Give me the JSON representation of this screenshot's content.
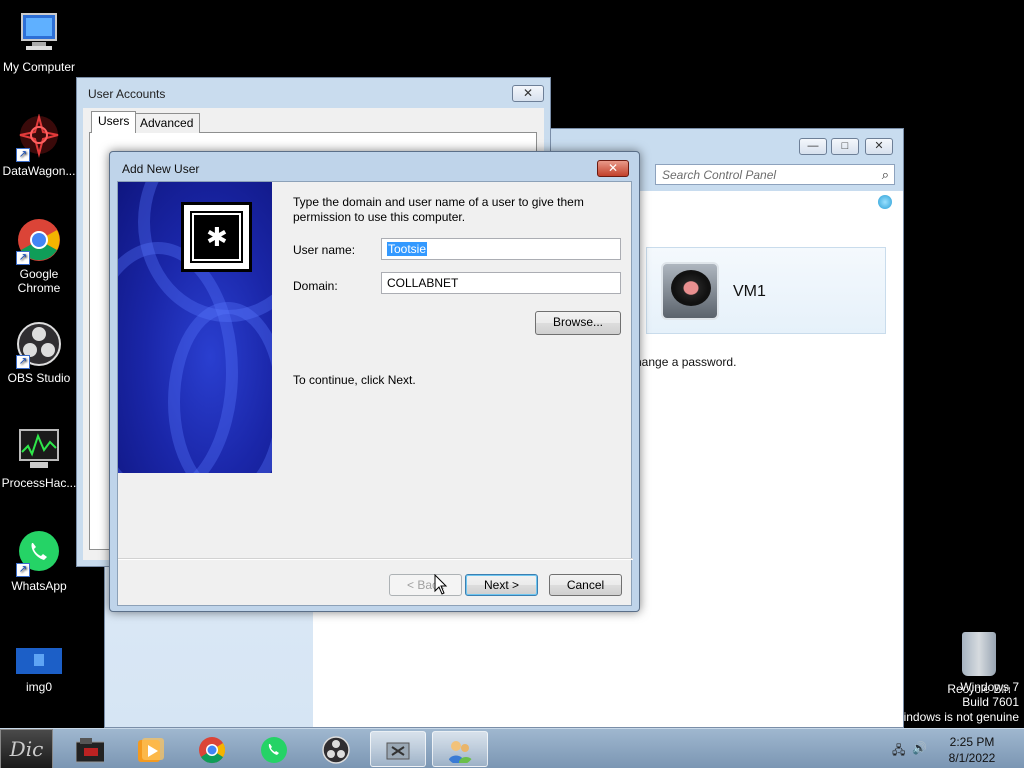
{
  "desktop": {
    "icons": [
      {
        "label": "My Computer"
      },
      {
        "label": "DataWagon..."
      },
      {
        "label": "Google Chrome"
      },
      {
        "label": "OBS Studio"
      },
      {
        "label": "ProcessHac..."
      },
      {
        "label": "WhatsApp"
      },
      {
        "label": "img0"
      }
    ],
    "recycle_bin": {
      "label": "Recycle Bin"
    },
    "watermark": {
      "line1": "Windows 7",
      "line2": "Build 7601",
      "line3": "indows is not genuine"
    }
  },
  "control_panel": {
    "search_placeholder": "Search Control Panel",
    "user_card_name": "VM1",
    "change_password_text": "hange a password."
  },
  "user_accounts": {
    "title": "User Accounts",
    "tabs": [
      "Users",
      "Advanced"
    ]
  },
  "add_user_dialog": {
    "title": "Add New User",
    "intro": "Type the domain and user name of a user to give them permission to use this computer.",
    "username_label": "User name:",
    "username_value": "Tootsie",
    "domain_label": "Domain:",
    "domain_value": "COLLABNET",
    "browse_label": "Browse...",
    "continue_text": "To continue, click Next.",
    "back_label": "< Back",
    "next_label": "Next >",
    "cancel_label": "Cancel"
  },
  "taskbar": {
    "start_label": "Dic",
    "time": "2:25 PM",
    "date": "8/1/2022"
  }
}
